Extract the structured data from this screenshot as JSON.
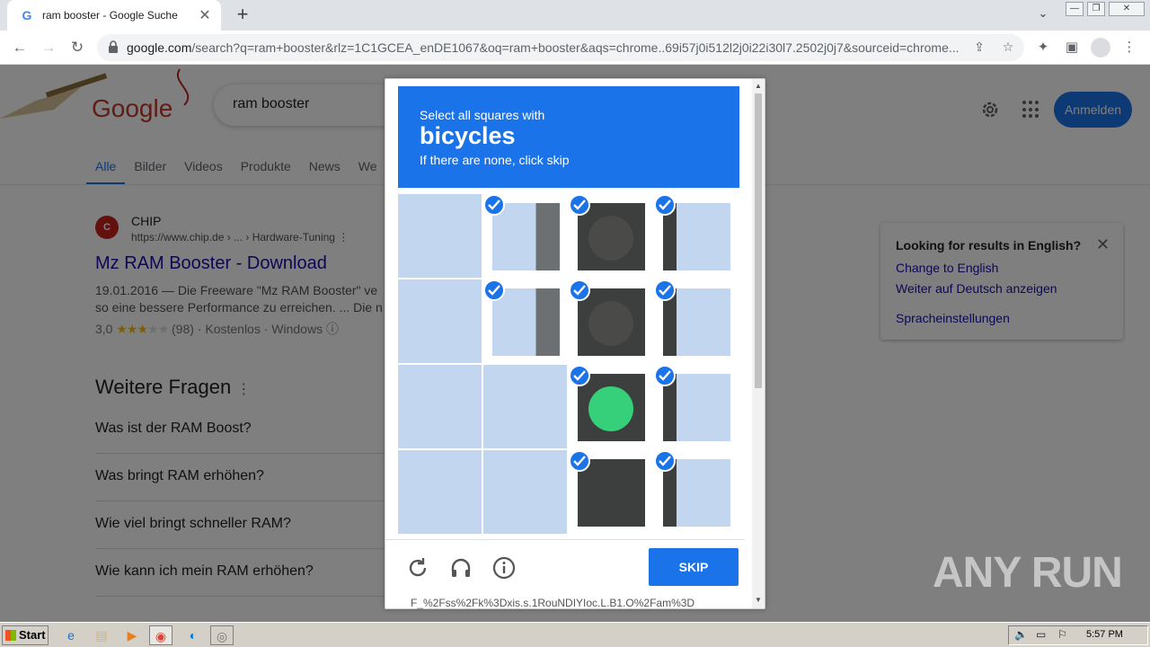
{
  "browser": {
    "tab_title": "ram booster - Google Suche",
    "url_domain": "google.com",
    "url_rest": "/search?q=ram+booster&rlz=1C1GCEA_enDE1067&oq=ram+booster&aqs=chrome..69i57j0i512l2j0i22i30l7.2502j0j7&sourceid=chrome..."
  },
  "google": {
    "logo": "Google",
    "query": "ram booster",
    "signin_label": "Anmelden",
    "tabs": [
      "Alle",
      "Bilder",
      "Videos",
      "Produkte",
      "News",
      "We"
    ],
    "result": {
      "favicon_text": "C",
      "site": "CHIP",
      "cite": "https://www.chip.de › ... › Hardware-Tuning",
      "title": "Mz RAM Booster - Download",
      "snippet1": "19.01.2016 — Die Freeware \"Mz RAM Booster\" ve",
      "snippet2": "so eine bessere Performance zu erreichen. ... Die n",
      "rating_value": "3,0",
      "rating_stars": 3,
      "rating_rest": "(98) · Kostenlos · Windows"
    },
    "paa_title": "Weitere Fragen",
    "paa_items": [
      "Was ist der RAM Boost?",
      "Was bringt RAM erhöhen?",
      "Wie viel bringt schneller RAM?",
      "Wie kann ich mein RAM erhöhen?"
    ],
    "lang_box": {
      "heading": "Looking for results in English?",
      "link1": "Change to English",
      "link2": "Weiter auf Deutsch anzeigen",
      "link3": "Spracheinstellungen"
    }
  },
  "captcha": {
    "line1": "Select all squares with",
    "target": "bicycles",
    "line3": "If there are none, click skip",
    "selected": [
      false,
      true,
      true,
      true,
      false,
      true,
      true,
      true,
      false,
      false,
      true,
      true,
      false,
      false,
      true,
      true
    ],
    "skip_label": "SKIP",
    "footer": "F_%2Fss%2Fk%3Dxis.s.1RouNDIYIoc.L.B1.O%2Fam%3D"
  },
  "watermark": "ANY RUN",
  "taskbar": {
    "start_label": "Start",
    "clock": "5:57 PM"
  }
}
